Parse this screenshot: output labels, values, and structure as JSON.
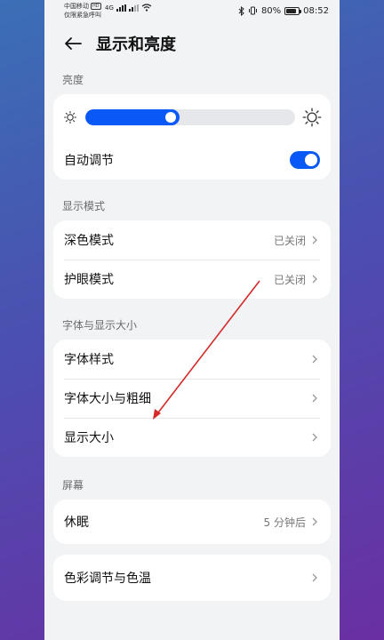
{
  "status_bar": {
    "carrier_line1": "中国移动",
    "hd": "HD",
    "carrier_line2": "仅限紧急呼叫",
    "network": "4G",
    "battery_percent": "80%",
    "time": "08:52"
  },
  "header": {
    "title": "显示和亮度"
  },
  "brightness": {
    "section_label": "亮度",
    "level": 0.45,
    "auto_label": "自动调节",
    "auto_enabled": true
  },
  "display_mode": {
    "section_label": "显示模式",
    "items": [
      {
        "label": "深色模式",
        "value": "已关闭"
      },
      {
        "label": "护眼模式",
        "value": "已关闭"
      }
    ]
  },
  "font_display": {
    "section_label": "字体与显示大小",
    "items": [
      {
        "label": "字体样式"
      },
      {
        "label": "字体大小与粗细"
      },
      {
        "label": "显示大小"
      }
    ]
  },
  "screen": {
    "section_label": "屏幕",
    "items": [
      {
        "label": "休眠",
        "value": "5 分钟后"
      }
    ],
    "color_item": {
      "label": "色彩调节与色温"
    }
  },
  "colors": {
    "accent": "#0a59f7",
    "annotation_arrow": "#d42a2a"
  }
}
